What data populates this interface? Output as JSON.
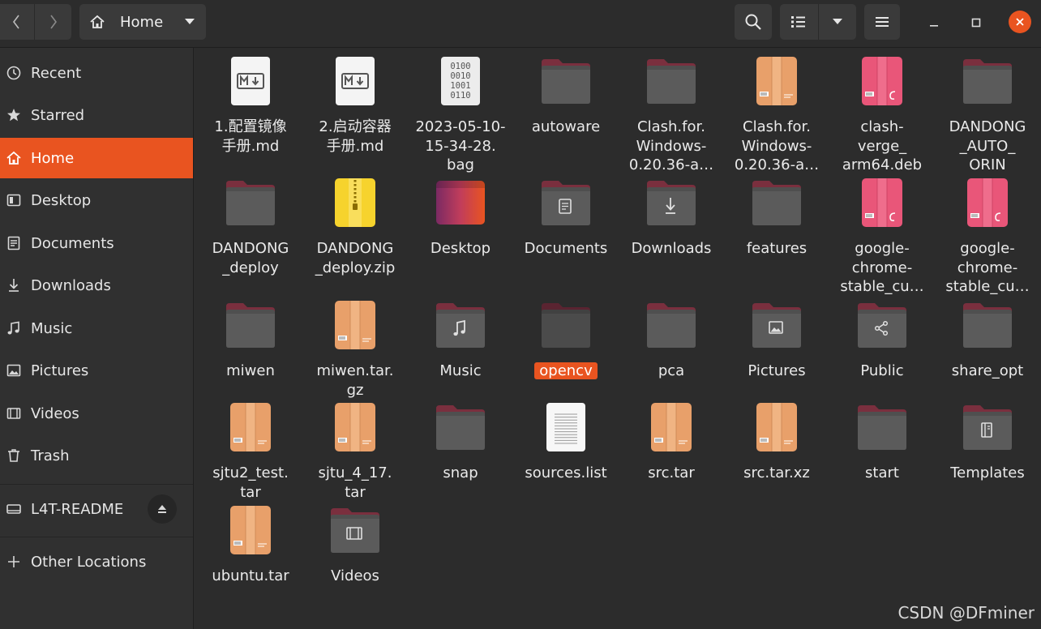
{
  "header": {
    "path_label": "Home"
  },
  "sidebar": {
    "items": [
      {
        "label": "Recent",
        "icon": "clock-icon"
      },
      {
        "label": "Starred",
        "icon": "star-icon"
      },
      {
        "label": "Home",
        "icon": "home-icon",
        "active": true
      },
      {
        "label": "Desktop",
        "icon": "desktop-icon"
      },
      {
        "label": "Documents",
        "icon": "documents-icon"
      },
      {
        "label": "Downloads",
        "icon": "download-icon"
      },
      {
        "label": "Music",
        "icon": "music-icon"
      },
      {
        "label": "Pictures",
        "icon": "pictures-icon"
      },
      {
        "label": "Videos",
        "icon": "videos-icon"
      },
      {
        "label": "Trash",
        "icon": "trash-icon"
      }
    ],
    "devices": [
      {
        "label": "L4T-README",
        "icon": "drive-icon"
      }
    ],
    "other_locations": "Other Locations"
  },
  "files": [
    {
      "name": "1.配置镜像\n手册.md",
      "type": "markdown"
    },
    {
      "name": "2.启动容器\n手册.md",
      "type": "markdown"
    },
    {
      "name": "2023-05-10-\n15-34-28.\nbag",
      "type": "binary"
    },
    {
      "name": "autoware",
      "type": "folder"
    },
    {
      "name": "Clash.for.\nWindows-\n0.20.36-a…",
      "type": "folder"
    },
    {
      "name": "Clash.for.\nWindows-\n0.20.36-a…",
      "type": "archive"
    },
    {
      "name": "clash-\nverge_\narm64.deb",
      "type": "deb"
    },
    {
      "name": "DANDONG\n_AUTO_\nORIN",
      "type": "folder"
    },
    {
      "name": "DANDONG\n_deploy",
      "type": "folder"
    },
    {
      "name": "DANDONG\n_deploy.zip",
      "type": "zip"
    },
    {
      "name": "Desktop",
      "type": "desktop"
    },
    {
      "name": "Documents",
      "type": "folder-documents"
    },
    {
      "name": "Downloads",
      "type": "folder-downloads"
    },
    {
      "name": "features",
      "type": "folder"
    },
    {
      "name": "google-\nchrome-\nstable_cu…",
      "type": "deb"
    },
    {
      "name": "google-\nchrome-\nstable_cu…",
      "type": "deb"
    },
    {
      "name": "miwen",
      "type": "folder"
    },
    {
      "name": "miwen.tar.\ngz",
      "type": "archive"
    },
    {
      "name": "Music",
      "type": "folder-music"
    },
    {
      "name": "opencv",
      "type": "folder-dark",
      "selected": true
    },
    {
      "name": "pca",
      "type": "folder"
    },
    {
      "name": "Pictures",
      "type": "folder-pictures"
    },
    {
      "name": "Public",
      "type": "folder-public"
    },
    {
      "name": "share_opt",
      "type": "folder"
    },
    {
      "name": "sjtu2_test.\ntar",
      "type": "archive"
    },
    {
      "name": "sjtu_4_17.\ntar",
      "type": "archive"
    },
    {
      "name": "snap",
      "type": "folder"
    },
    {
      "name": "sources.list",
      "type": "text"
    },
    {
      "name": "src.tar",
      "type": "archive"
    },
    {
      "name": "src.tar.xz",
      "type": "archive"
    },
    {
      "name": "start",
      "type": "folder"
    },
    {
      "name": "Templates",
      "type": "folder-templates"
    },
    {
      "name": "ubuntu.tar",
      "type": "archive"
    },
    {
      "name": "Videos",
      "type": "folder-videos"
    }
  ],
  "watermark": "CSDN @DFminer",
  "colors": {
    "accent": "#e95420",
    "background": "#2c2c2c",
    "sidebar": "#303030",
    "folder_body": "#5b5b5b",
    "folder_tab": "#7a2f3e"
  }
}
